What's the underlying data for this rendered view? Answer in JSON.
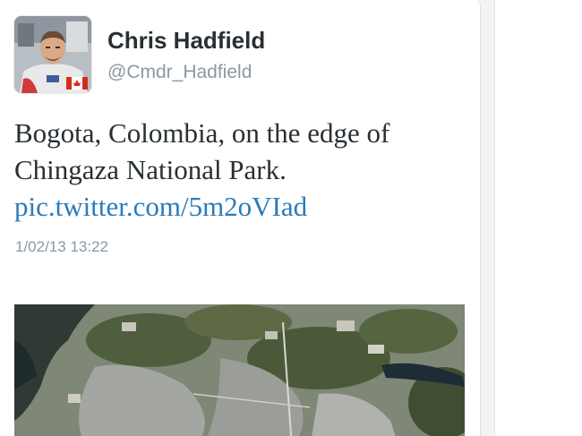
{
  "tweet": {
    "display_name": "Chris Hadfield",
    "username": "@Cmdr_Hadfield",
    "text_line1": "Bogota, Colombia, on the edge of",
    "text_line2": "Chingaza National Park.",
    "link": "pic.twitter.com/5m2oVIad",
    "timestamp": "1/02/13 13:22"
  },
  "colors": {
    "name": "#292f33",
    "secondary": "#8899a6",
    "link": "#2b7bb9",
    "background": "#ffffff"
  },
  "icons": {
    "avatar": "astronaut-avatar-icon",
    "flag": "canada-flag-icon"
  }
}
